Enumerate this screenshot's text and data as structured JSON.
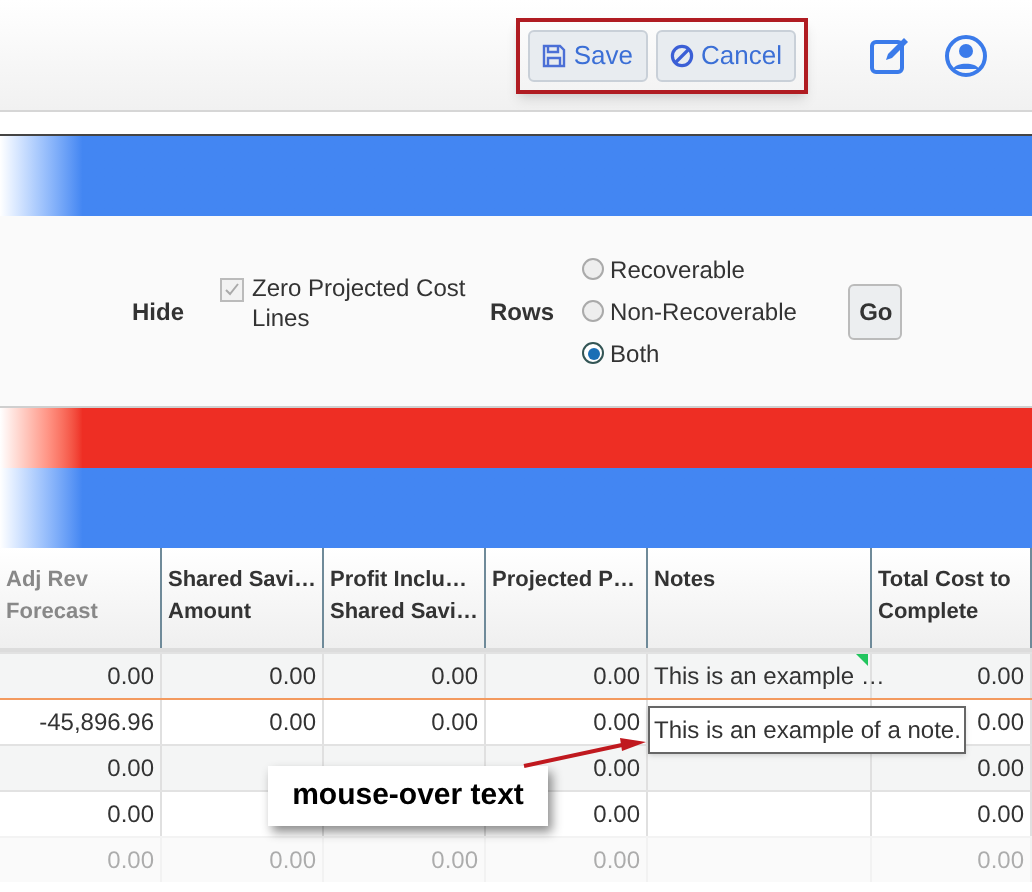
{
  "toolbar": {
    "buttons": [
      {
        "kind": "save",
        "label": "Save"
      },
      {
        "kind": "cancel",
        "label": "Cancel"
      }
    ]
  },
  "filters": {
    "hide_label": "Hide",
    "checkbox": {
      "label": "Zero Projected Cost Lines",
      "checked": true,
      "disabled": true
    },
    "rows_label": "Rows",
    "options": [
      {
        "label": "Recoverable",
        "selected": false
      },
      {
        "label": "Non-Recoverable",
        "selected": false
      },
      {
        "label": "Both",
        "selected": true
      }
    ],
    "go": "Go"
  },
  "table": {
    "columns": [
      "Adj Rev\nForecast",
      "Shared Savi…\nAmount",
      "Profit Inclu…\nShared Savi…",
      "Projected P…",
      "Notes",
      "Total Cost to\nComplete"
    ],
    "rows": [
      {
        "selected": false,
        "note_marker": true,
        "cells": [
          "0.00",
          "0.00",
          "0.00",
          "0.00",
          "This is an example …",
          "0.00"
        ]
      },
      {
        "selected": true,
        "note_marker": false,
        "cells": [
          "-45,896.96",
          "0.00",
          "0.00",
          "0.00",
          null,
          "0.00"
        ]
      },
      {
        "selected": false,
        "note_marker": false,
        "cells": [
          "0.00",
          null,
          null,
          "0.00",
          null,
          "0.00"
        ]
      },
      {
        "selected": false,
        "note_marker": false,
        "cells": [
          "0.00",
          null,
          null,
          "0.00",
          null,
          "0.00"
        ]
      },
      {
        "selected": false,
        "note_marker": false,
        "cells": [
          "0.00",
          "0.00",
          "0.00",
          "0.00",
          null,
          "0.00"
        ]
      }
    ]
  },
  "tooltip": "This is an example of a note.",
  "callout": "mouse-over text"
}
